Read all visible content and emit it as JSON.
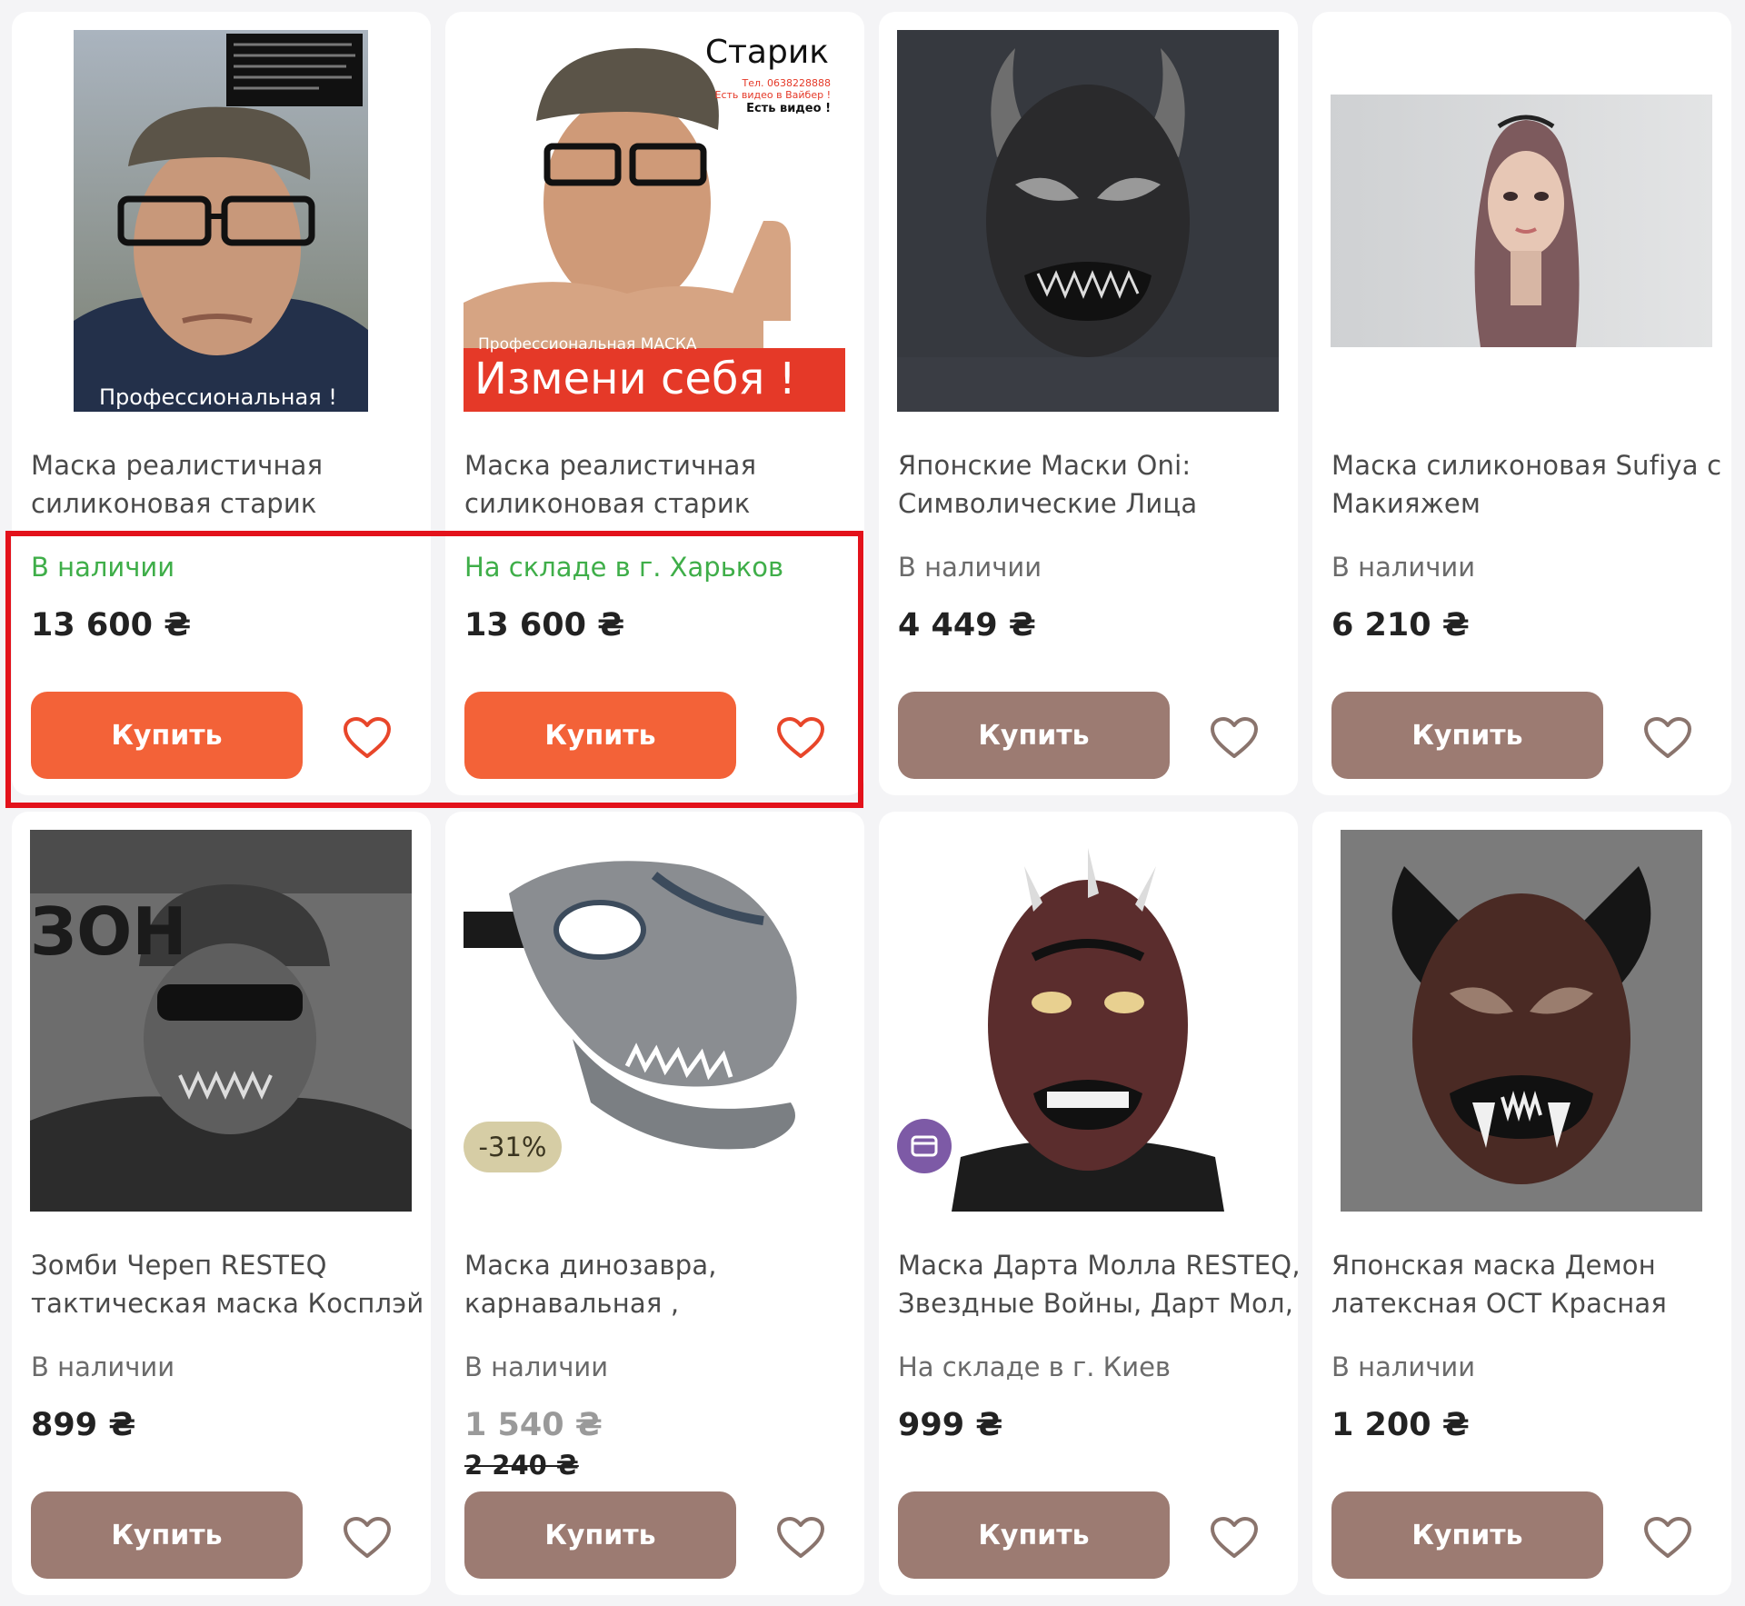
{
  "colors": {
    "buy_active": "#f36238",
    "buy_inactive": "#9c7b72",
    "in_stock_green": "#3fae49",
    "heart_active": "#e8462a",
    "heart_inactive": "#8a746d",
    "highlight_border": "#e3121b",
    "discount_badge": "#d6cda5",
    "installment_badge": "#7d5aa6"
  },
  "products": [
    {
      "title_line1": "Маска реалистичная",
      "title_line2": "силиконовая старик",
      "stock": "В наличии",
      "price": "13 600 ₴",
      "buy_label": "Купить",
      "image_overlay_text": "Профессиональная !",
      "image_icon": "old-man-mask-photo-icon"
    },
    {
      "title_line1": "Маска реалистичная",
      "title_line2": "силиконовая старик",
      "stock": "На складе в г. Харьков",
      "price": "13 600 ₴",
      "buy_label": "Купить",
      "image_heading": "Старик",
      "image_banner": "Измени себя !",
      "image_small_1": "Тел. 0638228888",
      "image_small_2": "Есть видео в Вайбер !",
      "image_small_3": "Есть видео !",
      "image_small_4": "Профессиональная МАСКА",
      "image_icon": "old-man-mask-thumbs-up-icon"
    },
    {
      "title_line1": "Японские Маски Oni:",
      "title_line2": "Символические Лица",
      "stock": "В наличии",
      "price": "4 449 ₴",
      "buy_label": "Купить",
      "image_icon": "oni-mask-icon"
    },
    {
      "title_line1": "Маска силиконовая Sufiya с",
      "title_line2": "Макияжем",
      "stock": "В наличии",
      "price": "6 210 ₴",
      "buy_label": "Купить",
      "image_icon": "female-silicone-mask-icon"
    },
    {
      "title_line1": "Зомби Череп RESTEQ",
      "title_line2": "тактическая маска Косплэй",
      "stock": "В наличии",
      "price": "899 ₴",
      "buy_label": "Купить",
      "image_icon": "zombie-skull-mask-icon",
      "image_wall_text": "ЗОН"
    },
    {
      "title_line1": "Маска динозавра,",
      "title_line2": "карнавальная ,",
      "stock": "В наличии",
      "price": "1 540 ₴",
      "old_price": "2 240 ₴",
      "discount": "-31%",
      "buy_label": "Купить",
      "image_icon": "dinosaur-mask-icon"
    },
    {
      "title_line1": "Маска Дарта Молла RESTEQ,",
      "title_line2": "Звездные Войны, Дарт Мол,",
      "stock": "На складе в г. Киев",
      "price": "999 ₴",
      "buy_label": "Купить",
      "image_icon": "darth-maul-mask-icon",
      "badge_icon": "installment-card-icon"
    },
    {
      "title_line1": "Японская маска Демон",
      "title_line2": "латексная OCT Красная",
      "stock": "В наличии",
      "price": "1 200 ₴",
      "buy_label": "Купить",
      "image_icon": "demon-mask-icon"
    }
  ]
}
